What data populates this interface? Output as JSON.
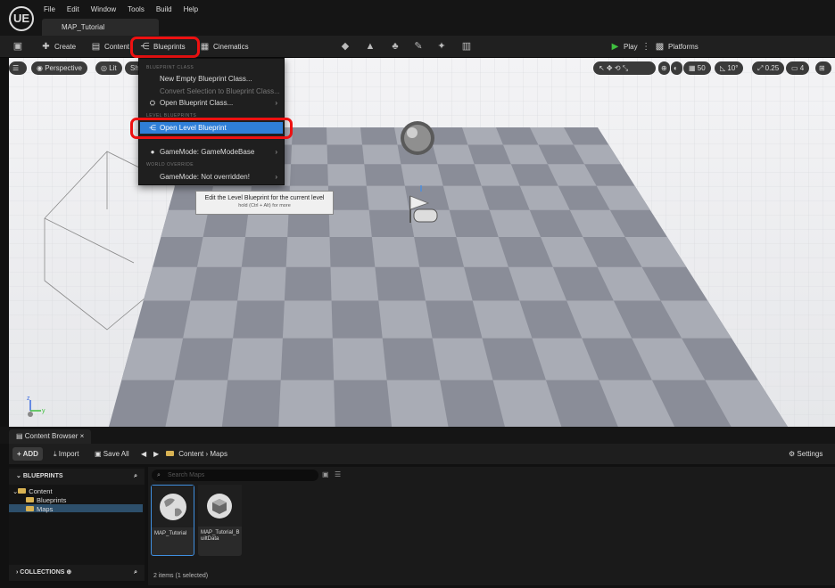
{
  "app": {
    "logo": "UE",
    "menu": [
      "File",
      "Edit",
      "Window",
      "Tools",
      "Build",
      "Help"
    ],
    "tab_title": "MAP_Tutorial"
  },
  "toolbar": {
    "create": "Create",
    "content": "Content",
    "blueprints": "Blueprints",
    "cinematics": "Cinematics",
    "play": "Play",
    "platforms": "Platforms"
  },
  "viewport": {
    "perspective": "Perspective",
    "lit": "Lit",
    "show": "Sh",
    "grid_snap": "50",
    "rotation_snap": "10°",
    "scale_snap": "0.25",
    "camera_speed": "4"
  },
  "blueprints_menu": {
    "header_class": "BLUEPRINT CLASS",
    "new_empty": "New Empty Blueprint Class...",
    "convert": "Convert Selection to Blueprint Class...",
    "open_class": "Open Blueprint Class...",
    "header_level": "LEVEL BLUEPRINTS",
    "open_level": "Open Level Blueprint",
    "gamemode": "GameMode: GameModeBase",
    "header_override": "WORLD OVERRIDE",
    "gamemode_override": "GameMode: Not overridden!"
  },
  "tooltip": {
    "main": "Edit the Level Blueprint for the current level",
    "hint": "hold (Ctrl + Alt) for more"
  },
  "content_browser": {
    "tab": "Content Browser",
    "add": "ADD",
    "import": "Import",
    "save_all": "Save All",
    "path": [
      "Content",
      "Maps"
    ],
    "settings": "Settings",
    "blueprints_section": "BLUEPRINTS",
    "collections_section": "COLLECTIONS",
    "tree": [
      "Content",
      "Blueprints",
      "Maps"
    ],
    "search_placeholder": "Search Maps",
    "assets": [
      {
        "name": "MAP_Tutorial"
      },
      {
        "name": "MAP_Tutorial_BuiltData"
      }
    ],
    "status": "2 items (1 selected)"
  },
  "colors": {
    "highlight_red": "#e11111",
    "menu_highlight": "#2f7fd8",
    "folder": "#d8b253"
  }
}
